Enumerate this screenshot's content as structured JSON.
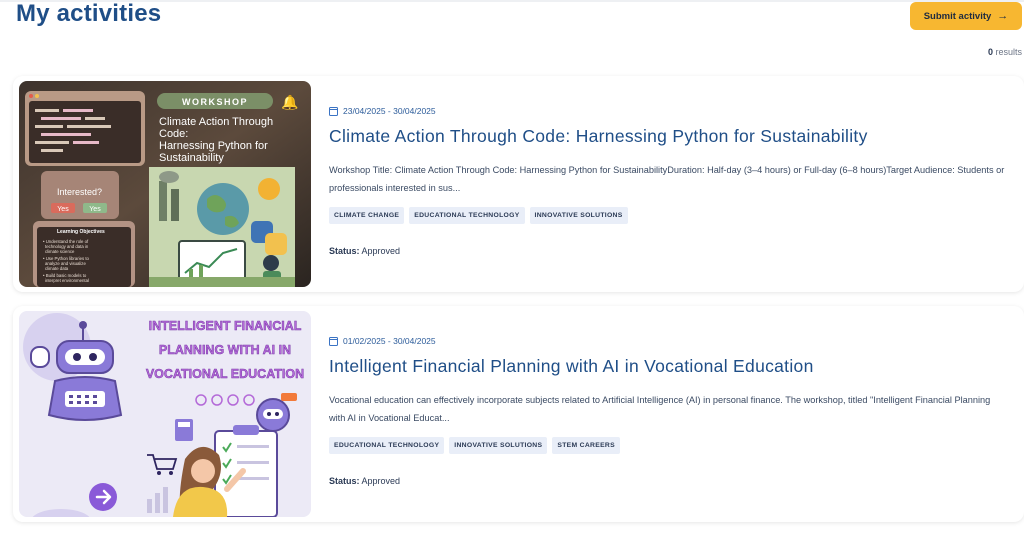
{
  "header": {
    "title": "My activities",
    "submit_label": "Submit activity",
    "results_count": "0",
    "results_label": "results"
  },
  "activities": [
    {
      "date": "23/04/2025 - 30/04/2025",
      "title": "Climate Action Through Code: Harnessing Python for Sustainability",
      "description": "Workshop Title: Climate Action Through Code: Harnessing Python for SustainabilityDuration: Half-day (3–4 hours) or Full-day (6–8 hours)Target Audience: Students or professionals interested in sus...",
      "tags": [
        "CLIMATE CHANGE",
        "EDUCATIONAL TECHNOLOGY",
        "INNOVATIVE SOLUTIONS"
      ],
      "status_label": "Status:",
      "status_value": "Approved",
      "thumb": {
        "badge": "WORKSHOP",
        "heading": "Climate Action Through Code: Harnessing Python for Sustainability",
        "interested": "Interested?",
        "yes1": "Yes",
        "yes2": "Yes",
        "objectives": "Learning Objectives",
        "obj_lines": [
          "Understand the role of technology and data in climate science",
          "Use Python libraries to analyze and visualize climate data",
          "Build basic models to interpret environmental trends"
        ]
      }
    },
    {
      "date": "01/02/2025 - 30/04/2025",
      "title": "Intelligent Financial Planning with AI in Vocational Education",
      "description": "Vocational education can effectively incorporate subjects related to Artificial Intelligence (AI) in personal finance. The workshop, titled \"Intelligent Financial Planning with AI in Vocational Educat...",
      "tags": [
        "EDUCATIONAL TECHNOLOGY",
        "INNOVATIVE SOLUTIONS",
        "STEM CAREERS"
      ],
      "status_label": "Status:",
      "status_value": "Approved",
      "thumb": {
        "line1": "INTELLIGENT FINANCIAL",
        "line2": "PLANNING WITH AI IN",
        "line3": "VOCATIONAL EDUCATION"
      }
    }
  ],
  "colors": {
    "title_blue": "#1f4e87",
    "button_yellow": "#f7b731",
    "tag_bg": "#e9eef8"
  }
}
